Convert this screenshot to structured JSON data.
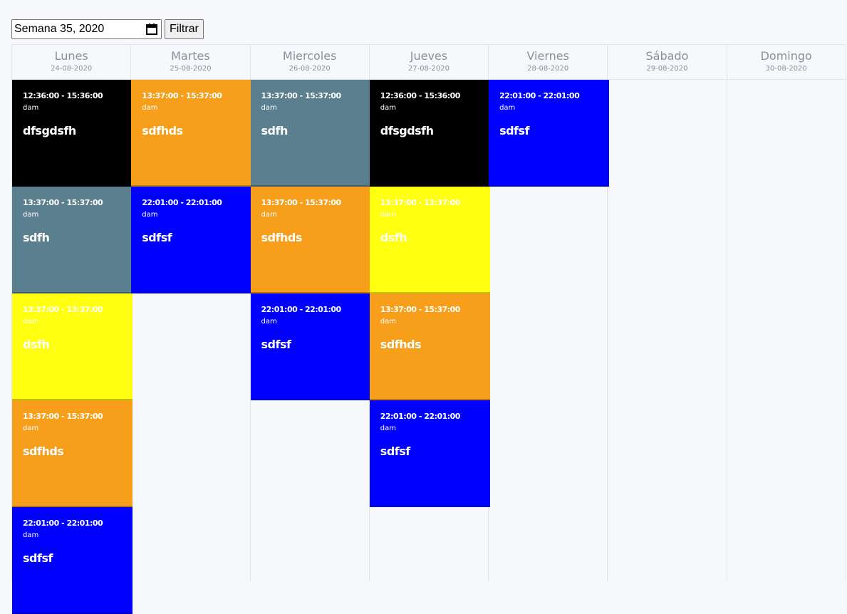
{
  "filter": {
    "week_value": "Semana 35, 2020",
    "button_label": "Filtrar"
  },
  "days": [
    {
      "name": "Lunes",
      "date": "24-08-2020"
    },
    {
      "name": "Martes",
      "date": "25-08-2020"
    },
    {
      "name": "Miercoles",
      "date": "26-08-2020"
    },
    {
      "name": "Jueves",
      "date": "27-08-2020"
    },
    {
      "name": "Viernes",
      "date": "28-08-2020"
    },
    {
      "name": "Sábado",
      "date": "29-08-2020"
    },
    {
      "name": "Domingo",
      "date": "30-08-2020"
    }
  ],
  "colors": {
    "black": "#000000",
    "orange": "#f79f1a",
    "slate": "#5a7f8e",
    "blue": "#0000ff",
    "yellow": "#ffff0f"
  },
  "events": [
    [
      {
        "time": "12:36:00 - 15:36:00",
        "user": "dam",
        "title": "dfsgdsfh",
        "color": "#000000"
      },
      {
        "time": "13:37:00 - 15:37:00",
        "user": "dam",
        "title": "sdfh",
        "color": "#5a7f8e"
      },
      {
        "time": "13:37:00 - 13:37:00",
        "user": "dam",
        "title": "dsfh",
        "color": "#ffff0f"
      },
      {
        "time": "13:37:00 - 15:37:00",
        "user": "dam",
        "title": "sdfhds",
        "color": "#f79f1a"
      },
      {
        "time": "22:01:00 - 22:01:00",
        "user": "dam",
        "title": "sdfsf",
        "color": "#0000ff"
      }
    ],
    [
      {
        "time": "13:37:00 - 15:37:00",
        "user": "dam",
        "title": "sdfhds",
        "color": "#f79f1a"
      },
      {
        "time": "22:01:00 - 22:01:00",
        "user": "dam",
        "title": "sdfsf",
        "color": "#0000ff"
      }
    ],
    [
      {
        "time": "13:37:00 - 15:37:00",
        "user": "dam",
        "title": "sdfh",
        "color": "#5a7f8e"
      },
      {
        "time": "13:37:00 - 15:37:00",
        "user": "dam",
        "title": "sdfhds",
        "color": "#f79f1a"
      },
      {
        "time": "22:01:00 - 22:01:00",
        "user": "dam",
        "title": "sdfsf",
        "color": "#0000ff"
      }
    ],
    [
      {
        "time": "12:36:00 - 15:36:00",
        "user": "dam",
        "title": "dfsgdsfh",
        "color": "#000000"
      },
      {
        "time": "13:37:00 - 13:37:00",
        "user": "dam",
        "title": "dsfh",
        "color": "#ffff0f"
      },
      {
        "time": "13:37:00 - 15:37:00",
        "user": "dam",
        "title": "sdfhds",
        "color": "#f79f1a"
      },
      {
        "time": "22:01:00 - 22:01:00",
        "user": "dam",
        "title": "sdfsf",
        "color": "#0000ff"
      }
    ],
    [
      {
        "time": "22:01:00 - 22:01:00",
        "user": "dam",
        "title": "sdfsf",
        "color": "#0000ff"
      }
    ],
    [],
    []
  ]
}
